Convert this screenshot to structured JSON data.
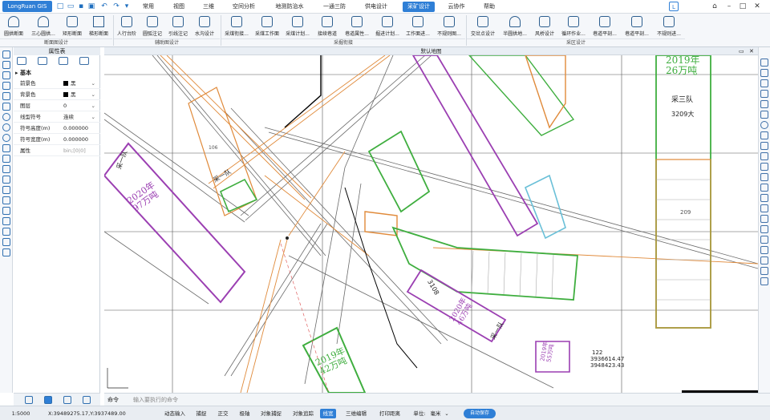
{
  "app": {
    "logo": "LongRuan GIS",
    "user_badge": "L"
  },
  "menu_tabs": [
    "常用",
    "视图",
    "三维",
    "空间分析",
    "地测防治水",
    "一通三防",
    "供电设计",
    "采矿设计",
    "云协作",
    "帮助"
  ],
  "active_tab": "采矿设计",
  "ribbon": {
    "buttons": [
      "圆拱断面",
      "三心圆拱...",
      "矩形断面",
      "梯形断面",
      "人行台阶",
      "圆弧注记",
      "引线注记",
      "水沟设计",
      "采煤衔接...",
      "采煤工作面",
      "采煤计划...",
      "接续巷道",
      "巷道属性...",
      "掘进计划...",
      "工作面进...",
      "不规则图...",
      "交岔点设计",
      "半圆拱地...",
      "风桥设计",
      "循环作业...",
      "巷道平剖...",
      "巷道平剖...",
      "不规则进..."
    ],
    "groups": [
      "断面图设计",
      "辅助图设计",
      "采掘衔接",
      "采区设计"
    ]
  },
  "props": {
    "title": "属性表",
    "section": "基本",
    "rows": [
      {
        "key": "前景色",
        "value": "黑",
        "swatch": "#000000"
      },
      {
        "key": "背景色",
        "value": "黑",
        "swatch": "#000000"
      },
      {
        "key": "图层",
        "value": "0"
      },
      {
        "key": "线型符号",
        "value": "连续"
      },
      {
        "key": "符号高度(m)",
        "value": "0.000000"
      },
      {
        "key": "符号宽度(m)",
        "value": "0.000000"
      },
      {
        "key": "属性",
        "value": "bin;[0|0]"
      }
    ]
  },
  "view": {
    "title": "默认地图",
    "labels": {
      "zone_2019_26": "2019年\n26万吨",
      "team3_top": "采三队",
      "num_3209": "3209大",
      "num_209": "209",
      "team1_left": "采一队",
      "zone_2020_97": "2020年\n97万吨",
      "team1_mid": "采一队",
      "num_3108": "3108",
      "zone_2020_46": "2020年\n46万吨",
      "team1_bottom": "采一队",
      "zone_2019_42": "2019年\n42万吨",
      "zone_small": "2019年\n55万吨",
      "coord_122": "122",
      "coord_y": "3936614.47",
      "coord_x": "3948423.43",
      "num_106": "106"
    }
  },
  "command": {
    "label": "命令",
    "placeholder": "输入要执行的命令"
  },
  "status": {
    "scale": "1:5000",
    "coords": "X:39489275.17,Y:3937489.00",
    "items": [
      "动态输入",
      "捕捉",
      "正交",
      "极轴",
      "对象捕捉",
      "对象追踪",
      "线宽",
      "三维编辑",
      "打印距离"
    ],
    "active_item": "线宽",
    "unit_label": "单位:",
    "unit_value": "毫米",
    "autosave": "自动保存"
  },
  "colors": {
    "accent": "#2f7fd6",
    "purple": "#9b3fb2",
    "green": "#3fae3f",
    "orange": "#e08a3a",
    "grey": "#555555"
  }
}
